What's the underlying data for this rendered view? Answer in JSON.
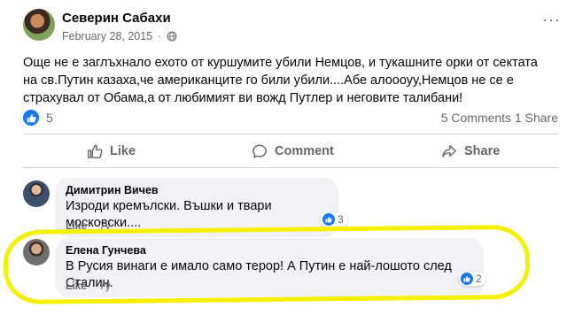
{
  "post": {
    "author": "Северин Сабахи",
    "date": "February 28, 2015",
    "separator": "·",
    "more_label": "···",
    "text": "Още не е заглъхнало ехото от куршумите убили Немцов, и тукашните орки от сектата на св.Путин казаха,че американците го били убили....Абе алоооуу,Немцов не се е страхувал от Обама,а от любимият ви вожд Путлер и неговите талибани!",
    "like_count": "5",
    "comments_count": "5 Comments",
    "shares_count": "1 Share"
  },
  "actions": {
    "like": "Like",
    "comment": "Comment",
    "share": "Share"
  },
  "comments": [
    {
      "name": "Димитрин Вичев",
      "text": "Изроди кремълски. Въшки и твари московски....",
      "like_label": "Like",
      "age": "7y",
      "reactions": "3"
    },
    {
      "name": "Елена Гунчева",
      "text": "В Русия винаги е имало само терор! А Путин е най-лошото след Сталин.",
      "like_label": "Like",
      "age": "7y",
      "reactions": "2"
    }
  ],
  "colors": {
    "accent": "#1877f2",
    "highlight": "#f4f000",
    "secondary_text": "#65676b",
    "bubble_bg": "#f0f2f5"
  }
}
